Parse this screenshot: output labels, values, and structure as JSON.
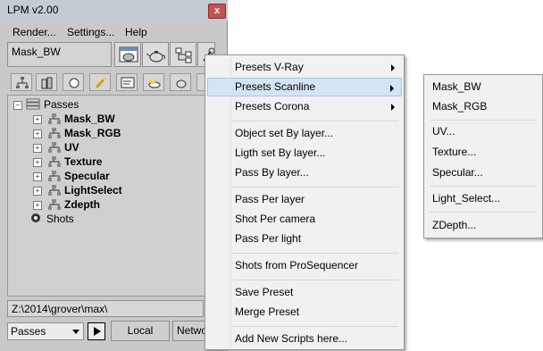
{
  "window": {
    "title": "LPM v2.00",
    "close_glyph": "x",
    "menubar": [
      "Render...",
      "Settings...",
      "Help"
    ],
    "preset_name": "Mask_BW",
    "tree": {
      "root": "Passes",
      "passes": [
        "Mask_BW",
        "Mask_RGB",
        "UV",
        "Texture",
        "Specular",
        "LightSelect",
        "Zdepth"
      ],
      "shots": "Shots"
    },
    "path": "Z:\\2014\\grover\\max\\",
    "mode_select": "Passes",
    "bottom_buttons": [
      "Local",
      "Netwo"
    ]
  },
  "context_menu": {
    "items": [
      "Presets V-Ray",
      "Presets Scanline",
      "Presets Corona",
      "Object set By layer...",
      "Ligth set By layer...",
      "Pass By layer...",
      "Pass Per layer",
      "Shot Per camera",
      "Pass Per light",
      "Shots from ProSequencer",
      "Save Preset",
      "Merge Preset",
      "Add New Scripts here..."
    ],
    "highlighted": "Presets Scanline"
  },
  "submenu": {
    "items": [
      "Mask_BW",
      "Mask_RGB",
      "UV...",
      "Texture...",
      "Specular...",
      "Light_Select...",
      "ZDepth..."
    ]
  },
  "colors": {
    "highlight_bg": "#d5e4f5",
    "close_red": "#c75050",
    "window_bg": "#c9c9c9"
  }
}
